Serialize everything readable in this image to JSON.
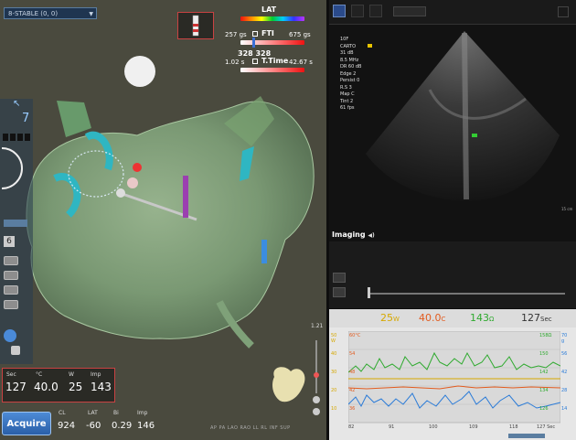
{
  "map": {
    "stable_label": "8-STABLE (0, 0)",
    "lat_label": "LAT",
    "fti_min": "257 gs",
    "fti_label": "FTI",
    "fti_max": "675 gs",
    "fti_values": "328  328",
    "ttime_min": "1.02 s",
    "ttime_label": "T.Time",
    "ttime_max": "42.67 s",
    "side_number": "7",
    "side_small_number": "6",
    "zoom_value": "1.21",
    "views_label": "AP  PA  LAO  RAO  LL  RL  INF  SUP"
  },
  "readout": {
    "headers": [
      "Sec",
      "°C",
      "W",
      "Imp"
    ],
    "values": [
      "127",
      "40.0",
      "25",
      "143"
    ]
  },
  "bottom": {
    "acquire_label": "Acquire",
    "headers": [
      "CL",
      "LAT",
      "Bi",
      "Imp"
    ],
    "values": [
      "924",
      "-60",
      "0.29",
      "146"
    ]
  },
  "ultrasound": {
    "info_lines": [
      "10F",
      "CARTO",
      "31 dB",
      "8.5 MHz",
      "DR 60 dB",
      "Edge 2",
      "Persist 0",
      "R.S 3",
      "Map C",
      "Tint 2",
      "61 fps"
    ],
    "imaging_label": "Imaging",
    "depth_label": "15 cm"
  },
  "graph": {
    "power": "25",
    "power_unit": "W",
    "temp": "40.0",
    "temp_unit": "C",
    "imp": "143",
    "imp_unit": "Ω",
    "time": "127",
    "time_unit": "Sec",
    "left_ticks": [
      "50 W",
      "40",
      "30",
      "20",
      "10"
    ],
    "left_ticks2": [
      "60°C",
      "54",
      "48",
      "42",
      "36"
    ],
    "right_ticks": [
      "158Ω",
      "150",
      "142",
      "134",
      "126"
    ],
    "right_ticks2": [
      "70 g",
      "56",
      "42",
      "28",
      "14"
    ],
    "x_ticks": [
      "82",
      "91",
      "100",
      "109",
      "118",
      "127 Sec"
    ],
    "colors": {
      "power": "#d6a800",
      "temp": "#e25b1e",
      "imp": "#2faa2f",
      "time": "#333333",
      "contact": "#2a7bd8"
    }
  }
}
